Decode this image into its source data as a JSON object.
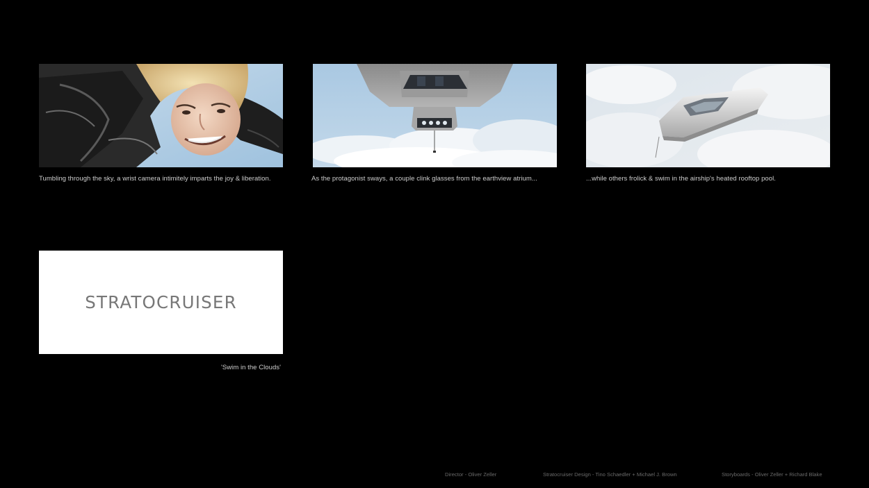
{
  "panels": [
    {
      "illustration": "woman-skydiving-closeup",
      "caption": "Tumbling through the sky, a wrist camera intimitely imparts the joy & liberation."
    },
    {
      "illustration": "airship-underside-view",
      "caption": "As the protagonist sways, a couple clink glasses from the earthview atrium..."
    },
    {
      "illustration": "airship-side-view-clouds",
      "caption": "...while others frolick & swim in the airship's heated rooftop pool."
    }
  ],
  "title_card": {
    "title": "STRATOCRUISER",
    "subtitle": "'Swim in the Clouds'"
  },
  "credits": {
    "director": "Director - Oliver Zeller",
    "design": "Stratocruiser Design - Tino Schaedler + Michael J. Brown",
    "storyboards": "Storyboards - Oliver Zeller + Richard Blake"
  },
  "colors": {
    "background": "#000000",
    "caption": "#cfcfcf",
    "credit": "#6a6a6a",
    "title": "#777777",
    "sky": "#a9c8e2"
  }
}
